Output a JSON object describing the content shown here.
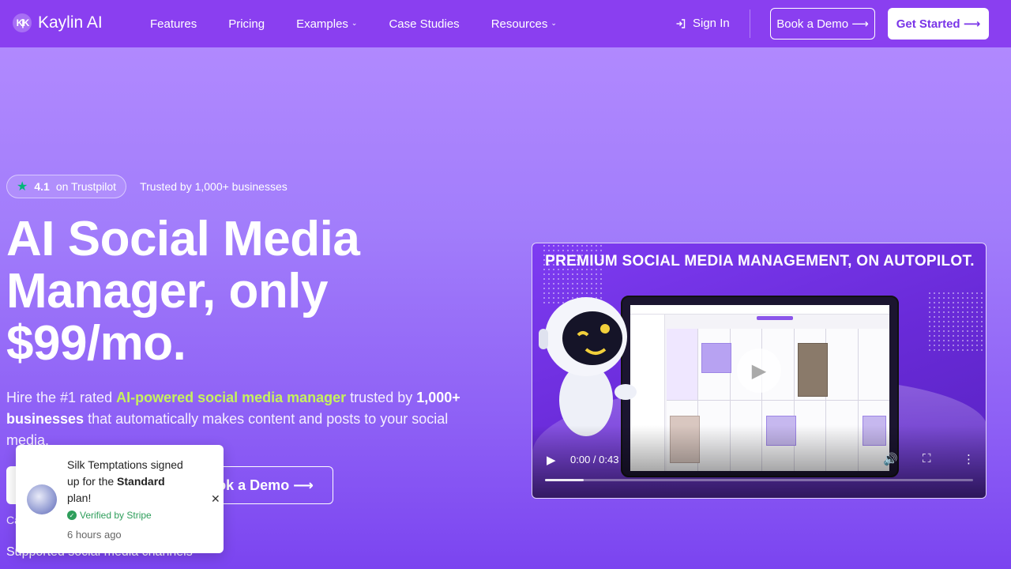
{
  "nav": {
    "brand": "Kaylin AI",
    "logo_mark": "K|K",
    "links": [
      {
        "label": "Features"
      },
      {
        "label": "Pricing"
      },
      {
        "label": "Examples"
      },
      {
        "label": "Case Studies"
      },
      {
        "label": "Resources"
      }
    ],
    "sign_in": "Sign In",
    "book_demo": "Book a Demo ⟶",
    "get_started": "Get Started ⟶"
  },
  "hero": {
    "rating": "4.1",
    "rating_source": "on Trustpilot",
    "trusted": "Trusted by 1,000+ businesses",
    "headline": "AI Social Media Manager, only $99/mo.",
    "sub_prefix": "Hire the #1 rated ",
    "sub_highlight": "AI-powered social media manager",
    "sub_middle": " trusted by ",
    "sub_bold": "1,000+ businesses",
    "sub_suffix": " that automatically makes content and posts to your social media.",
    "cta_demo": "ok a Demo ⟶",
    "small_note": "Ca",
    "supported_label": "Supported social media channels"
  },
  "toast": {
    "msg_prefix": "Silk Temptations signed up for the ",
    "plan": "Standard",
    "msg_suffix": " plan!",
    "verified": "Verified by Stripe",
    "time": "6 hours ago",
    "close": "✕"
  },
  "video": {
    "title": "PREMIUM SOCIAL MEDIA MANAGEMENT, ON AUTOPILOT.",
    "time": "0:00 / 0:43",
    "progress": 0.09
  },
  "colors": {
    "nav_bg": "#8a3ff0",
    "accent_green": "#c6f15e",
    "trustpilot_star": "#00b67a",
    "stripe_verified": "#2e9e5b",
    "button_text_purple": "#7a35e8"
  },
  "icons": {
    "sign_in": "sign-in-icon",
    "star": "star-icon",
    "chevron": "chevron-down-icon",
    "play": "play-icon",
    "volume": "volume-icon",
    "fullscreen": "fullscreen-icon",
    "more": "more-vertical-icon",
    "check": "check-circle-icon",
    "close": "close-icon"
  }
}
